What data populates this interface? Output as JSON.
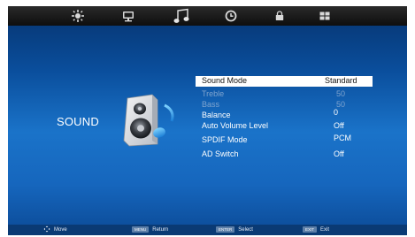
{
  "tabs": [
    {
      "icon": "picture-settings-icon"
    },
    {
      "icon": "screen-icon"
    },
    {
      "icon": "music-note-icon"
    },
    {
      "icon": "clock-icon"
    },
    {
      "icon": "lock-icon"
    },
    {
      "icon": "grid-icon"
    }
  ],
  "panel": {
    "title": "SOUND",
    "icon": "speaker-music-icon"
  },
  "menu": [
    {
      "label": "Sound Mode",
      "value": "Standard"
    },
    {
      "label": "Treble",
      "value": "50"
    },
    {
      "label": "Bass",
      "value": "50"
    },
    {
      "label": "Balance",
      "value": "0"
    },
    {
      "label": "Auto Volume Level",
      "value": "Off"
    },
    {
      "label": "SPDIF Mode",
      "value": "PCM"
    },
    {
      "label": "AD Switch",
      "value": "Off"
    }
  ],
  "hints": {
    "move": "Move",
    "return_key": "MENU",
    "return": "Return",
    "select_key": "ENTER",
    "select": "Select",
    "exit_key": "EXIT",
    "exit": "Exit"
  },
  "colors": {
    "accent": "#1a73c9",
    "selected_bg": "#ffffff",
    "dim_text": "#7fa4cf"
  }
}
